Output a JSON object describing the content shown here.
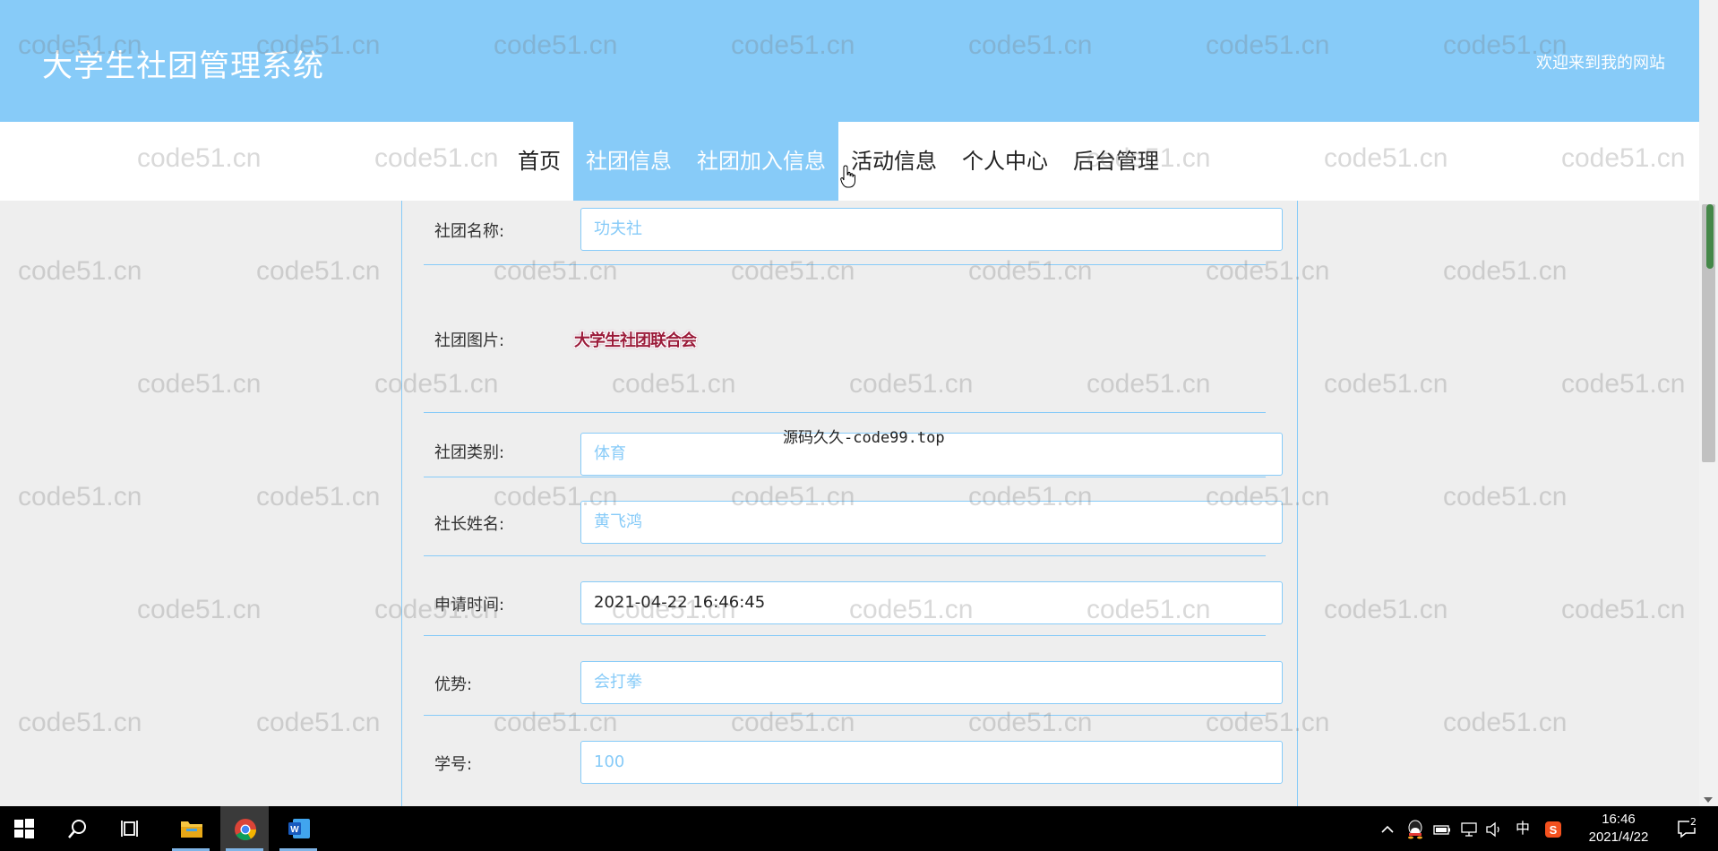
{
  "header": {
    "title": "大学生社团管理系统",
    "welcome": "欢迎来到我的网站"
  },
  "nav": {
    "items": [
      {
        "label": "首页"
      },
      {
        "label": "社团信息"
      },
      {
        "label": "社团加入信息"
      },
      {
        "label": "活动信息"
      },
      {
        "label": "个人中心"
      },
      {
        "label": "后台管理"
      }
    ]
  },
  "form": {
    "fields": [
      {
        "label": "社团名称:",
        "value": "功夫社"
      },
      {
        "label": "社团图片:",
        "value": "大学生社团联合会"
      },
      {
        "label": "社团类别:",
        "value": "体育"
      },
      {
        "label": "社长姓名:",
        "value": "黄飞鸿"
      },
      {
        "label": "申请时间:",
        "value": "2021-04-22 16:46:45"
      },
      {
        "label": "优势:",
        "value": "会打拳"
      },
      {
        "label": "学号:",
        "value": "100"
      }
    ]
  },
  "overlay_text": "源码久久-code99.top",
  "watermark": "code51.cn",
  "taskbar": {
    "tray_ime": "中",
    "time": "16:46",
    "date": "2021/4/22",
    "notification_count": "2"
  },
  "colors": {
    "header_bg": "#87cbf8",
    "accent": "#87cbf8",
    "page_bg": "#eeeeee"
  }
}
